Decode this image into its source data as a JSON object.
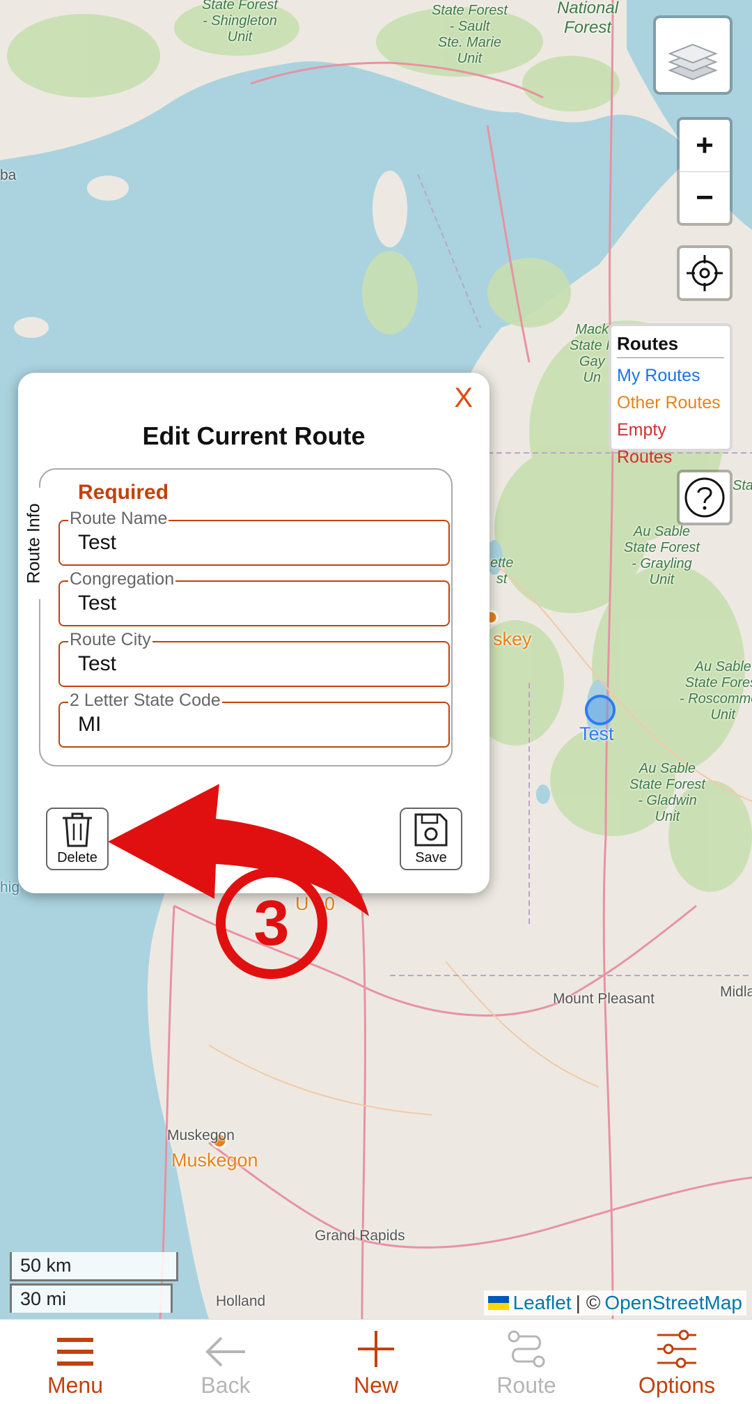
{
  "map": {
    "forest_labels": [
      {
        "text": "State Forest\n- Shingleton\nUnit"
      },
      {
        "text": "State Forest\n- Sault\nSte. Marie\nUnit"
      },
      {
        "text": "National\nForest"
      },
      {
        "text": "Au Sable\nState Forest\n- Grayling\nUnit"
      },
      {
        "text": "Au Sable\nState Forest\n- Roscommon\nUnit"
      },
      {
        "text": "Au Sable\nState Forest\n- Gladwin\nUnit"
      },
      {
        "text": "Mack\nState F\nGay\nUn"
      },
      {
        "text": "ette\nst"
      },
      {
        "text": "Sta"
      }
    ],
    "city_labels": [
      "Mount Pleasant",
      "Midla",
      "Grand Rapids",
      "Holland",
      "Muskegon"
    ],
    "orange_labels": [
      "skey",
      "Muskegon",
      "U 10"
    ],
    "partial_labels": [
      "ba",
      "hig"
    ],
    "marker_label": "Test"
  },
  "controls": {
    "zoom_in": "+",
    "zoom_out": "−"
  },
  "legend": {
    "title": "Routes",
    "items": [
      {
        "label": "My Routes",
        "color": "#1a73e8"
      },
      {
        "label": "Other Routes",
        "color": "#e8811a"
      },
      {
        "label": "Empty Routes",
        "color": "#d32f2f"
      }
    ]
  },
  "scale": {
    "km": "50 km",
    "mi": "30 mi"
  },
  "attribution": {
    "leaflet": "Leaflet",
    "sep": "| ©",
    "osm": "OpenStreetMap"
  },
  "dialog": {
    "close": "X",
    "title": "Edit Current Route",
    "section": "Route Info",
    "required": "Required",
    "fields": [
      {
        "label": "Route Name",
        "value": "Test"
      },
      {
        "label": "Congregation",
        "value": "Test"
      },
      {
        "label": "Route City",
        "value": "Test"
      },
      {
        "label": "2 Letter State Code",
        "value": "MI"
      }
    ],
    "delete": "Delete",
    "save": "Save"
  },
  "annotation": {
    "step": "3",
    "color": "#e01010"
  },
  "bottom_nav": [
    {
      "label": "Menu",
      "enabled": true
    },
    {
      "label": "Back",
      "enabled": false
    },
    {
      "label": "New",
      "enabled": true
    },
    {
      "label": "Route",
      "enabled": false
    },
    {
      "label": "Options",
      "enabled": true
    }
  ],
  "colors": {
    "accent": "#c2410c",
    "water": "#aad3df",
    "land": "#ede9e2",
    "forest": "#c8dfb0"
  }
}
